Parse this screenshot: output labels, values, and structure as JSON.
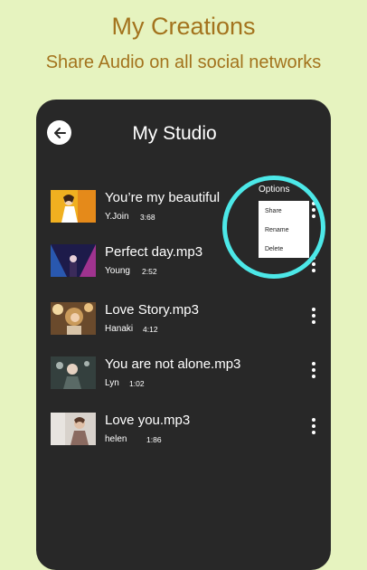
{
  "promo": {
    "title": "My Creations",
    "subtitle": "Share Audio on all social networks"
  },
  "header": {
    "title": "My Studio",
    "back_icon": "arrow-left-icon"
  },
  "tracks": [
    {
      "title": "You’re my beautiful",
      "artist": "Y.Join",
      "duration": "3:68"
    },
    {
      "title": "Perfect day.mp3",
      "artist": "Young",
      "duration": "2:52"
    },
    {
      "title": "Love Story.mp3",
      "artist": "Hanaki",
      "duration": "4:12"
    },
    {
      "title": "You are not alone.mp3",
      "artist": "Lyn",
      "duration": "1:02"
    },
    {
      "title": "Love you.mp3",
      "artist": "helen",
      "duration": "1:86"
    }
  ],
  "options_menu": {
    "label": "Options",
    "items": [
      "Share",
      "Rename",
      "Delete"
    ]
  },
  "colors": {
    "background": "#e6f3bf",
    "accent_text": "#a3731d",
    "panel": "#282828",
    "highlight": "#4ce8e8"
  }
}
